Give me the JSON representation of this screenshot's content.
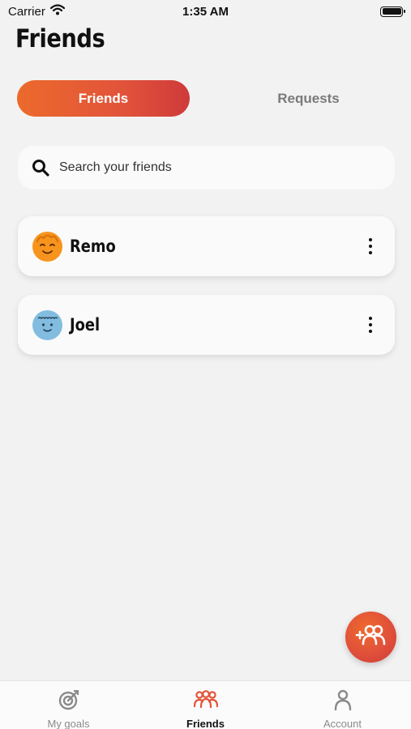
{
  "status_bar": {
    "carrier": "Carrier",
    "time": "1:35 AM"
  },
  "header": {
    "title": "Friends"
  },
  "tabs": [
    {
      "label": "Friends",
      "active": true
    },
    {
      "label": "Requests",
      "active": false
    }
  ],
  "search": {
    "placeholder": "Search your friends",
    "value": ""
  },
  "friends": [
    {
      "name": "Remo",
      "avatar_icon": "smiling-face-icon",
      "avatar_color": "#f7941d"
    },
    {
      "name": "Joel",
      "avatar_icon": "face-icon",
      "avatar_color": "#82bde0"
    }
  ],
  "fab": {
    "icon": "add-friend-icon"
  },
  "bottom_nav": [
    {
      "label": "My goals",
      "icon": "target-icon",
      "active": false
    },
    {
      "label": "Friends",
      "icon": "friends-icon",
      "active": true
    },
    {
      "label": "Account",
      "icon": "person-icon",
      "active": false
    }
  ],
  "colors": {
    "accent": "#e2543a",
    "background": "#f2f2f2"
  }
}
